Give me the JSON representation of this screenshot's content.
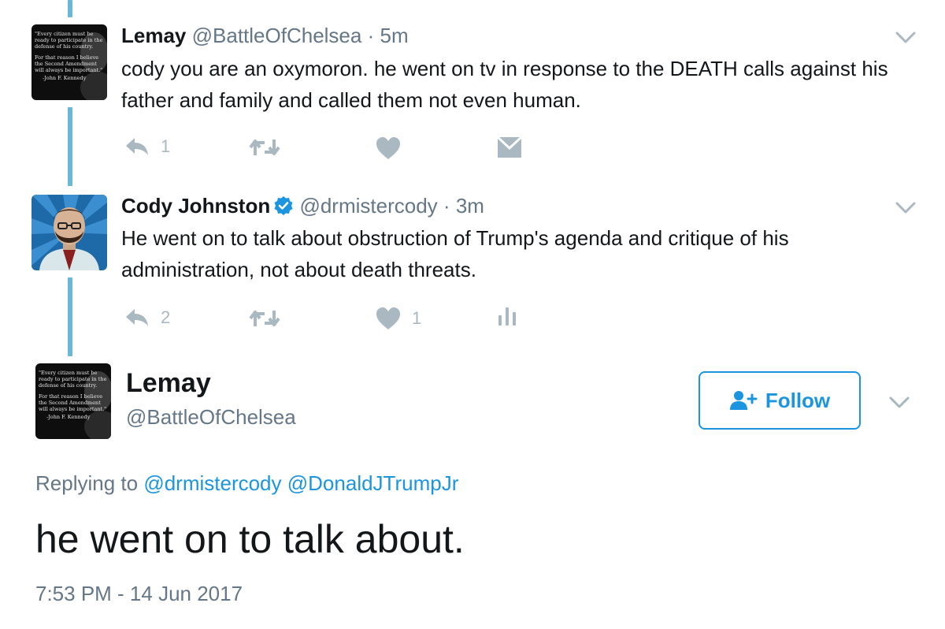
{
  "tweets": [
    {
      "name": "Lemay",
      "handle": "@BattleOfChelsea",
      "separator": "·",
      "time": "5m",
      "text": "cody you are an oxymoron. he went on tv in response to the DEATH calls against his father and family and called them not even human.",
      "avatar_icon": "quote-avatar",
      "actions": {
        "reply_count": "1",
        "retweet_count": "",
        "like_count": "",
        "fourth_icon": "direct-message-icon"
      }
    },
    {
      "name": "Cody Johnston",
      "verified": true,
      "handle": "@drmistercody",
      "separator": "·",
      "time": "3m",
      "text": "He went on to talk about obstruction of Trump's agenda and critique of his administration, not about death threats.",
      "avatar_icon": "illustrated-portrait-avatar",
      "actions": {
        "reply_count": "2",
        "retweet_count": "",
        "like_count": "1",
        "fourth_icon": "analytics-icon"
      }
    }
  ],
  "main_tweet": {
    "name": "Lemay",
    "handle": "@BattleOfChelsea",
    "follow_label": "Follow",
    "replying_prefix": "Replying to",
    "replying_to": [
      "@drmistercody",
      "@DonaldJTrumpJr"
    ],
    "text": "he went on to talk about.",
    "timestamp": "7:53 PM - 14 Jun 2017"
  },
  "avatar_quote_lines": [
    "\"Every citizen must be",
    "ready to participate in the",
    "defense of his country.",
    "For that reason I believe",
    "the Second Amendment",
    "will always be important.\"",
    "-John F. Kennedy"
  ],
  "colors": {
    "thread_line": "#6cb6d8",
    "accent": "#1b95e0",
    "muted": "#657786",
    "icon_gray": "#aab8c2"
  }
}
